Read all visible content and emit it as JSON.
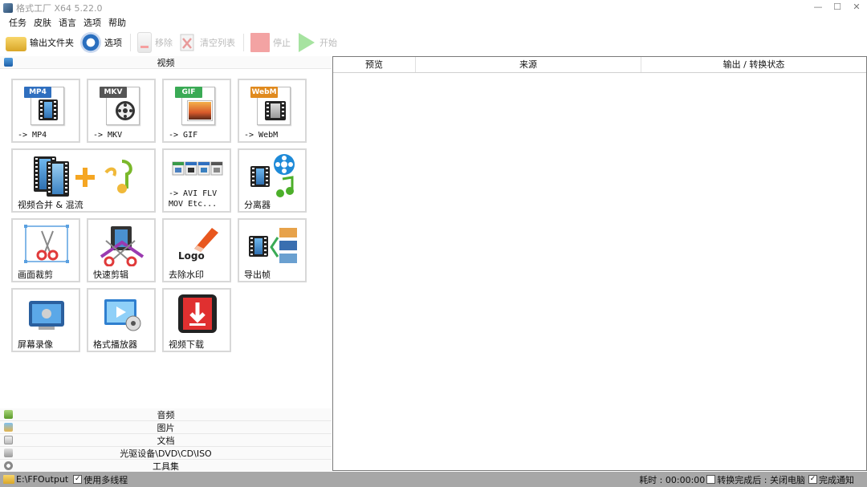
{
  "window": {
    "title": "格式工厂 X64 5.22.0",
    "controls": {
      "minimize": "—",
      "maximize": "☐",
      "close": "✕"
    }
  },
  "menu": [
    "任务",
    "皮肤",
    "语言",
    "选项",
    "帮助"
  ],
  "toolbar": {
    "output_folder": "输出文件夹",
    "options": "选项",
    "remove": "移除",
    "clear_list": "清空列表",
    "stop": "停止",
    "start": "开始"
  },
  "left": {
    "video_header": "视频",
    "tiles": [
      {
        "id": "mp4",
        "label": "-> MP4",
        "badge": "MP4",
        "badge_color": "#2f6fbf"
      },
      {
        "id": "mkv",
        "label": "-> MKV",
        "badge": "MKV",
        "badge_color": "#555555"
      },
      {
        "id": "gif",
        "label": "-> GIF",
        "badge": "GIF",
        "badge_color": "#3aaa55"
      },
      {
        "id": "webm",
        "label": "-> WebM",
        "badge": "WebM",
        "badge_color": "#e08a1e"
      },
      {
        "id": "merge",
        "label": "视频合并 & 混流"
      },
      {
        "id": "avi",
        "label": "-> AVI FLV\nMOV Etc..."
      },
      {
        "id": "splitter",
        "label": "分离器"
      },
      {
        "id": "crop",
        "label": "画面裁剪"
      },
      {
        "id": "quickcut",
        "label": "快速剪辑"
      },
      {
        "id": "watermark",
        "label": "去除水印",
        "logo_text": "Logo"
      },
      {
        "id": "frames",
        "label": "导出帧"
      },
      {
        "id": "screenrec",
        "label": "屏幕录像"
      },
      {
        "id": "player",
        "label": "格式播放器"
      },
      {
        "id": "download",
        "label": "视频下载"
      }
    ],
    "sections": [
      "音频",
      "图片",
      "文档",
      "光驱设备\\DVD\\CD\\ISO",
      "工具集"
    ]
  },
  "table": {
    "columns": [
      "预览",
      "来源",
      "输出 / 转换状态"
    ]
  },
  "status": {
    "path": "E:\\FFOutput",
    "multithread": {
      "label": "使用多线程",
      "checked": true
    },
    "elapsed": "耗时 : 00:00:00",
    "after_complete": {
      "label": "转换完成后 : 关闭电脑",
      "checked": false
    },
    "notify": {
      "label": "完成通知",
      "checked": true
    },
    "check_mark": "✓"
  },
  "colors": {
    "statusbar": "#a7a7a7",
    "tile_border": "#d8d8d8"
  }
}
